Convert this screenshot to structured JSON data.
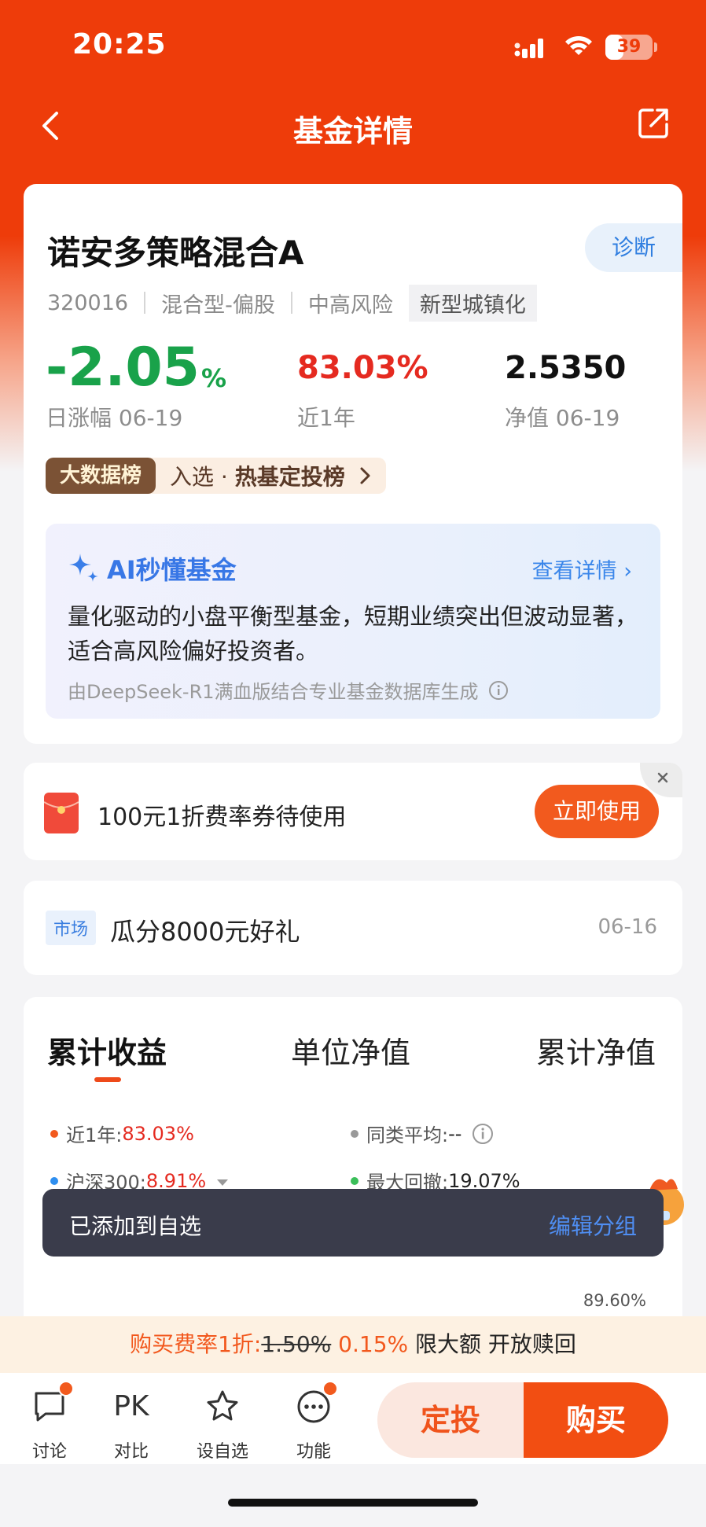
{
  "status_bar": {
    "time": "20:25",
    "battery": "39",
    "battery_level": 0.39
  },
  "nav": {
    "title": "基金详情"
  },
  "fund": {
    "name": "诺安多策略混合A",
    "diagnose": "诊断",
    "code": "320016",
    "type": "混合型-偏股",
    "risk": "中高风险",
    "theme_tag": "新型城镇化",
    "daily_change": "-2.05",
    "daily_change_unit": "%",
    "daily_change_label": "日涨幅 06-19",
    "one_year_return": "83.03%",
    "one_year_label": "近1年",
    "nav_value": "2.5350",
    "nav_label": "净值 06-19",
    "rank_badge": "大数据榜",
    "rank_prefix": "入选 · ",
    "rank_name": "热基定投榜"
  },
  "ai": {
    "title": "AI秒懂基金",
    "more": "查看详情",
    "body": "量化驱动的小盘平衡型基金，短期业绩突出但波动显著，适合高风险偏好投资者。",
    "source": "由DeepSeek-R1满血版结合专业基金数据库生成"
  },
  "coupon": {
    "text": "100元1折费率券待使用",
    "button": "立即使用"
  },
  "market": {
    "tag": "市场",
    "text": "瓜分8000元好礼",
    "date": "06-16"
  },
  "chart_tabs": [
    "累计收益",
    "单位净值",
    "累计净值"
  ],
  "legend": {
    "one_year_label": "近1年:",
    "one_year_value": "83.03%",
    "peer_label": "同类平均:",
    "peer_value": "--",
    "index_label": "沪深300:",
    "index_value": "8.91%",
    "drawdown_label": "最大回撤:",
    "drawdown_value": "19.07%",
    "chart_top_value": "89.60%",
    "colors": {
      "fund": "#f25a1e",
      "peer": "#999999",
      "index": "#2f8ff0",
      "drawdown": "#3bbf5a"
    }
  },
  "toast": {
    "text": "已添加到自选",
    "action": "编辑分组"
  },
  "fee": {
    "prefix": "购买费率1折:",
    "old_rate": "1.50%",
    "new_rate": "0.15%",
    "suffix": "限大额 开放赎回"
  },
  "bottom": {
    "discuss": "讨论",
    "pk": "PK",
    "compare": "对比",
    "watch": "设自选",
    "more": "功能",
    "invest": "定投",
    "buy": "购买"
  }
}
